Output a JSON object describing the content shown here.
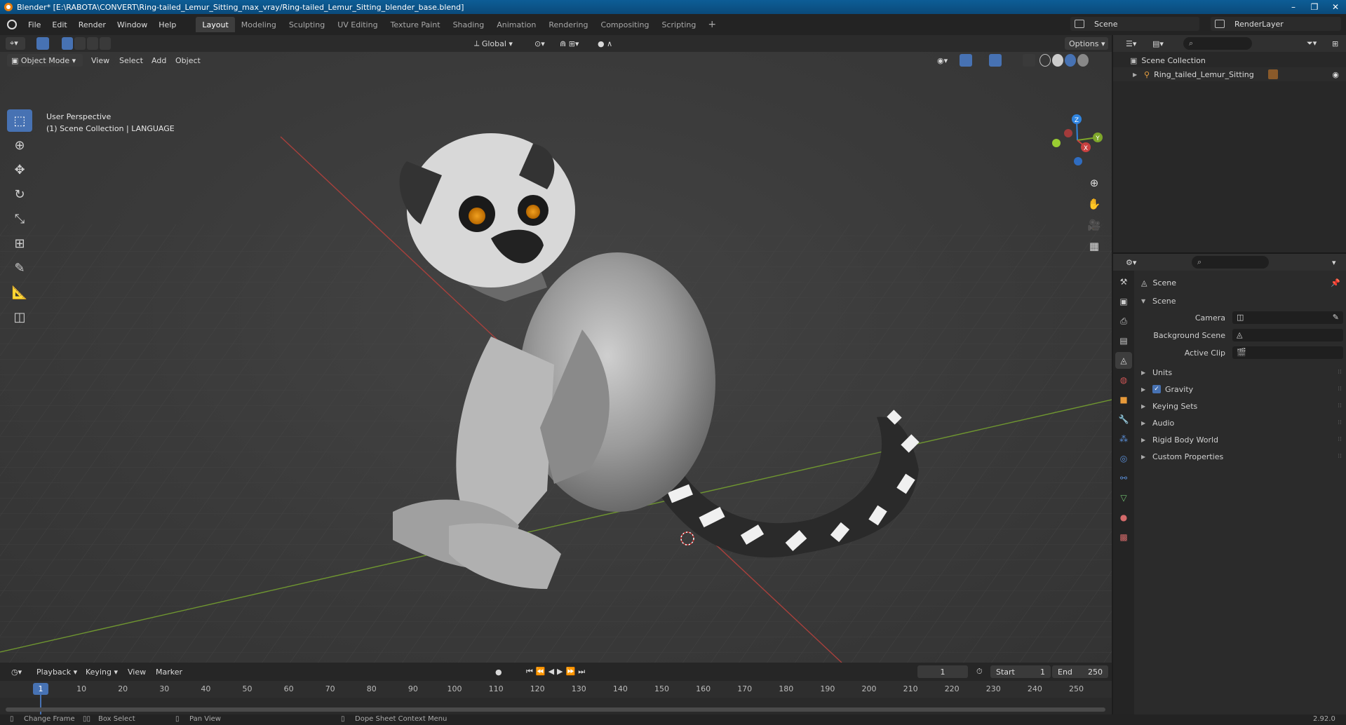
{
  "window": {
    "title": "Blender* [E:\\RABOTA\\CONVERT\\Ring-tailed_Lemur_Sitting_max_vray/Ring-tailed_Lemur_Sitting_blender_base.blend]",
    "minimize": "–",
    "restore": "❐",
    "close": "✕"
  },
  "menus": [
    "File",
    "Edit",
    "Render",
    "Window",
    "Help"
  ],
  "workspaces": [
    "Layout",
    "Modeling",
    "Sculpting",
    "UV Editing",
    "Texture Paint",
    "Shading",
    "Animation",
    "Rendering",
    "Compositing",
    "Scripting"
  ],
  "workspace_add": "+",
  "scene_name": "Scene",
  "render_layer": "RenderLayer",
  "viewport": {
    "mode": "Object Mode",
    "menus": [
      "View",
      "Select",
      "Add",
      "Object"
    ],
    "transform_orientation": "Global",
    "options": "Options",
    "perspective": "User Perspective",
    "collection_info": "(1) Scene Collection | LANGUAGE",
    "gizmo_axes": {
      "x": "X",
      "y": "Y",
      "z": "Z"
    }
  },
  "timeline": {
    "menus": [
      "Playback",
      "Keying",
      "View",
      "Marker"
    ],
    "current_frame": "1",
    "start_label": "Start",
    "start": "1",
    "end_label": "End",
    "end": "250",
    "ruler": [
      "10",
      "20",
      "30",
      "40",
      "50",
      "60",
      "70",
      "80",
      "90",
      "100",
      "110",
      "120",
      "130",
      "140",
      "150",
      "160",
      "170",
      "180",
      "190",
      "200",
      "210",
      "220",
      "230",
      "240",
      "250"
    ],
    "playhead": "1"
  },
  "statusbar": {
    "change_frame": "Change Frame",
    "box_select": "Box Select",
    "pan_view": "Pan View",
    "context_menu": "Dope Sheet Context Menu",
    "version": "2.92.0"
  },
  "outliner": {
    "root": "Scene Collection",
    "item": "Ring_tailed_Lemur_Sitting"
  },
  "properties": {
    "context": "Scene",
    "section": "Scene",
    "camera_label": "Camera",
    "background_scene_label": "Background Scene",
    "active_clip_label": "Active Clip",
    "panels": [
      "Units",
      "Gravity",
      "Keying Sets",
      "Audio",
      "Rigid Body World",
      "Custom Properties"
    ]
  },
  "colors": {
    "accent": "#4772b3",
    "titlebar": "#0d5d96",
    "axis_x": "#c8403f",
    "axis_y": "#7ea62a",
    "axis_z": "#2f84e0"
  }
}
